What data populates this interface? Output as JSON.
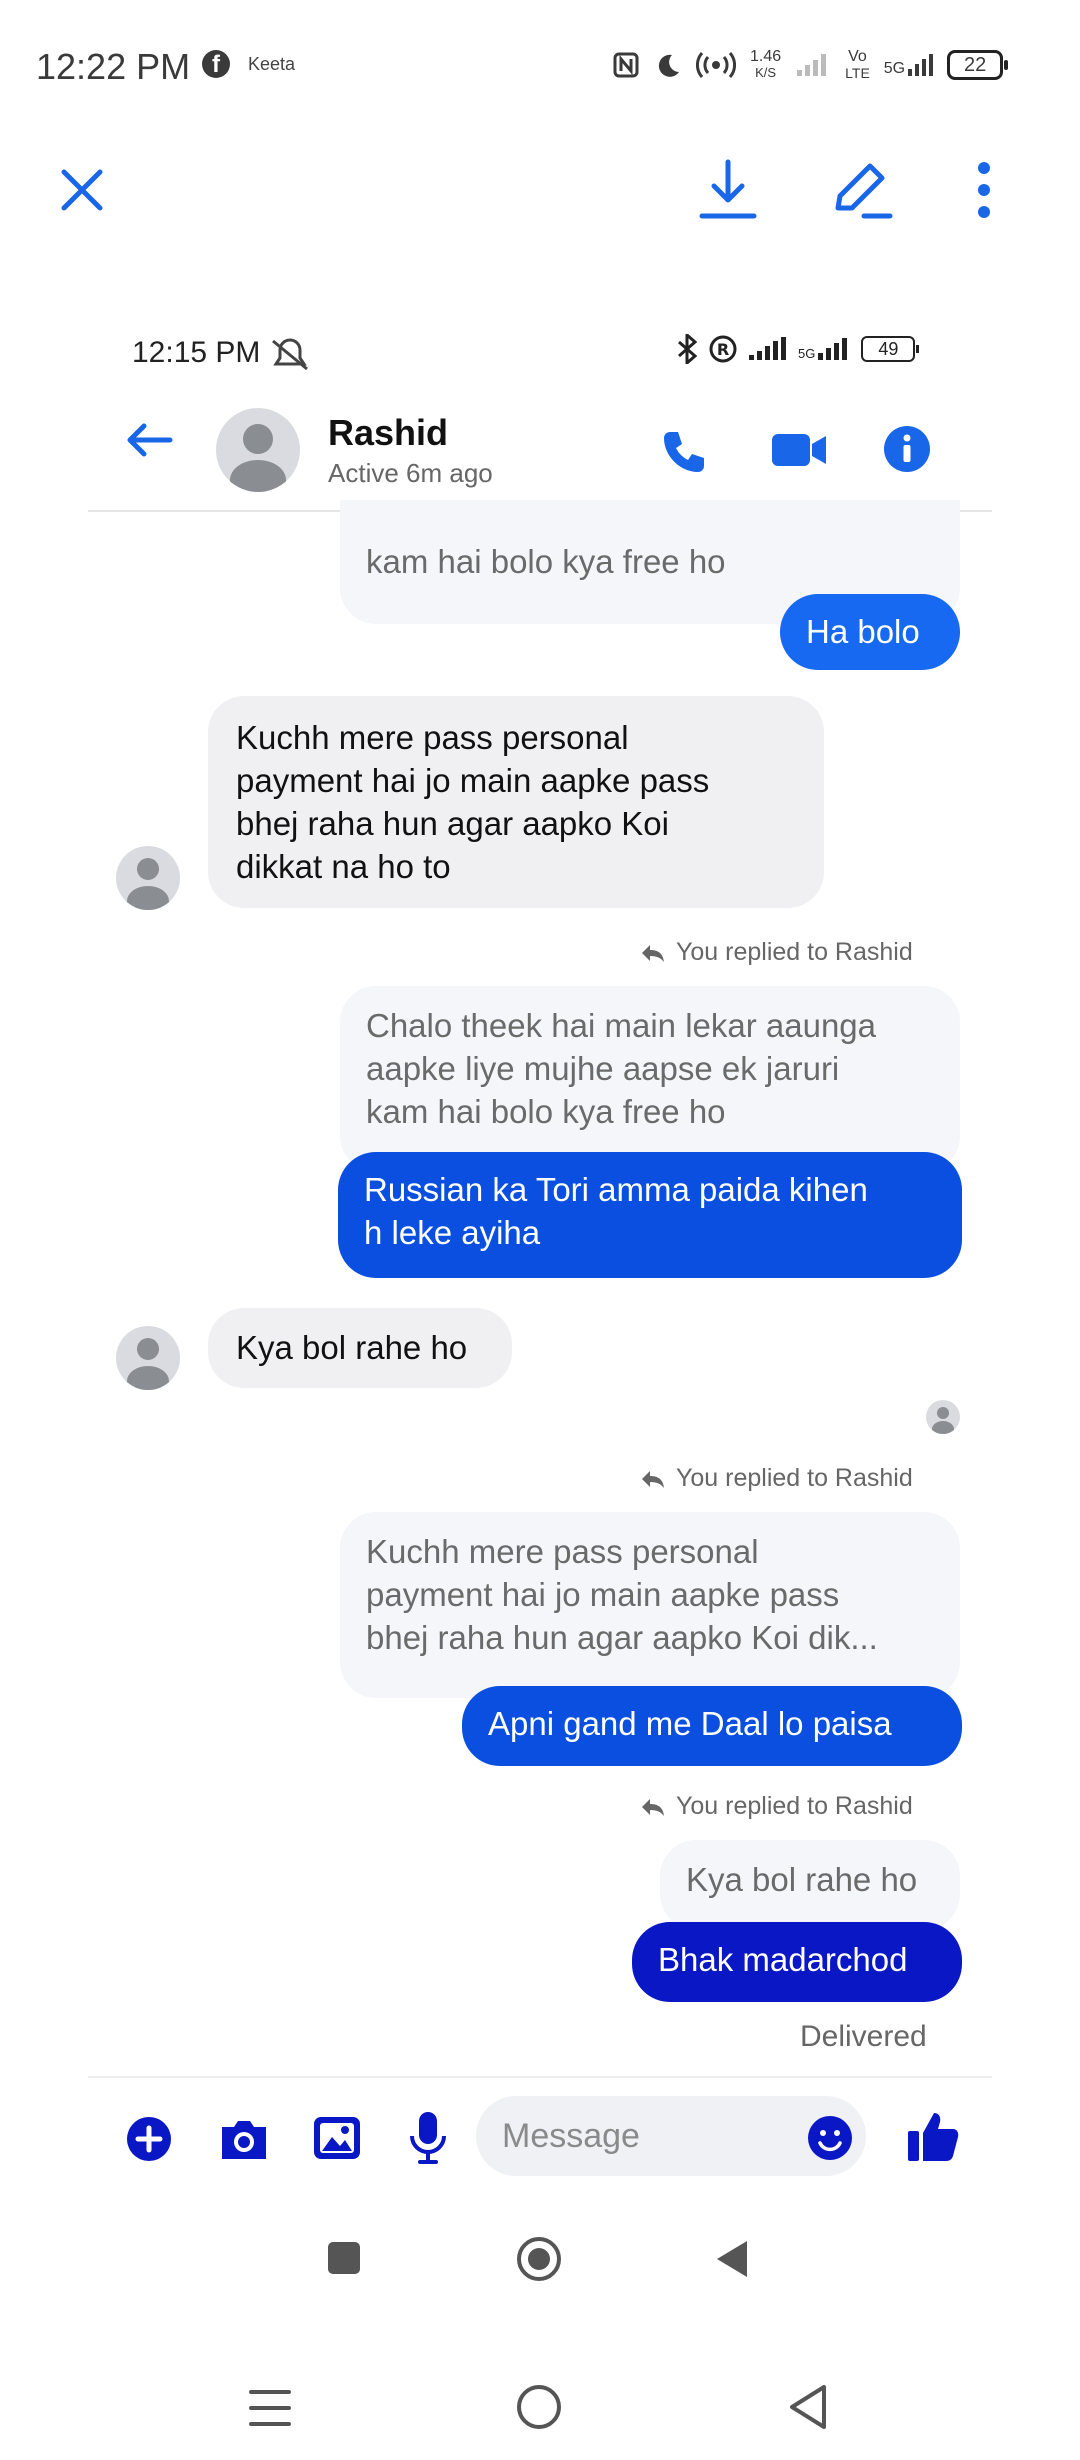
{
  "outer_status": {
    "time": "12:22 PM",
    "app_tag": "Keeta",
    "network_speed": "1.46",
    "network_speed_unit": "K/S",
    "volte": "Vo",
    "volte_sub": "LTE",
    "fiveg": "5G",
    "battery": "22"
  },
  "inner_status": {
    "time": "12:15 PM",
    "fiveg": "5G",
    "battery": "49"
  },
  "contact": {
    "name": "Rashid",
    "status": "Active 6m ago"
  },
  "messages": {
    "partial_quote": "kam hai bolo kya free ho",
    "out1": "Ha bolo",
    "in1_line1": "Kuchh mere pass personal",
    "in1_line2": "payment hai jo main aapke pass",
    "in1_line3": "bhej raha hun agar aapko Koi",
    "in1_line4": "dikkat na ho to",
    "reply_note_1": "You replied to Rashid",
    "quote1_line1": "Chalo theek hai main lekar aaunga",
    "quote1_line2": "aapke liye mujhe aapse ek jaruri",
    "quote1_line3": "kam hai bolo kya free ho",
    "out2_line1": "Russian ka Tori amma paida kihen",
    "out2_line2": "h leke ayiha",
    "in2": "Kya bol rahe ho",
    "reply_note_2": "You replied to Rashid",
    "quote2_line1": "Kuchh mere pass personal",
    "quote2_line2": "payment hai jo main aapke pass",
    "quote2_line3": "bhej raha hun agar aapko Koi dik...",
    "out3": "Apni gand me Daal lo paisa",
    "reply_note_3": "You replied to Rashid",
    "quote3": "Kya bol rahe ho",
    "out4": "Bhak madarchod",
    "delivered": "Delivered"
  },
  "composer": {
    "placeholder": "Message"
  },
  "colors": {
    "accent": "#1a66e8",
    "bubble_blue": "#0b4fe0",
    "bubble_dark": "#0a17c4",
    "bubble_light": "#1769f2"
  },
  "icons": [
    "close-icon",
    "download-icon",
    "edit-icon",
    "more-icon",
    "back-arrow-icon",
    "phone-icon",
    "video-icon",
    "info-icon",
    "plus-icon",
    "camera-icon",
    "gallery-icon",
    "mic-icon",
    "emoji-icon",
    "like-icon",
    "reply-icon",
    "recents-icon",
    "home-icon",
    "back-icon",
    "menu-icon"
  ]
}
